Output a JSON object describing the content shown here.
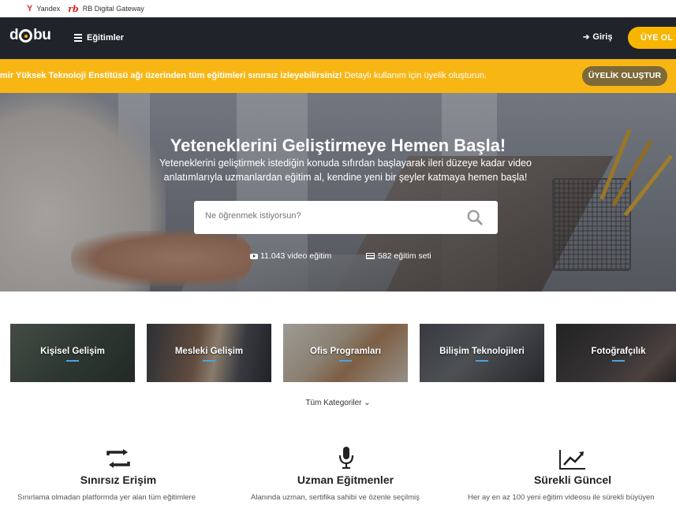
{
  "bookmarks": [
    {
      "icon": "Y",
      "label": "Yandex"
    },
    {
      "icon": "rb",
      "label": "RB Digital Gateway"
    }
  ],
  "navbar": {
    "logo": "dobu",
    "menu_label": "Eğitimler",
    "login_label": "Giriş",
    "join_label": "ÜYE OL"
  },
  "notice": {
    "bold_text": "mir Yüksek Teknoloji Enstitüsü ağı üzerinden tüm eğitimleri sınırsız izleyebilirsiniz!",
    "text": " Detaylı kullanım için üyelik oluşturun.",
    "button_label": "ÜYELİK OLUŞTUR"
  },
  "hero": {
    "title": "Yeteneklerini Geliştirmeye Hemen Başla!",
    "subtitle": "Yeteneklerini geliştirmek istediğin konuda sıfırdan başlayarak ileri düzeye kadar video anlatımlarıyla uzmanlardan eğitim al, kendine yeni bir şeyler katmaya hemen başla!",
    "search_placeholder": "Ne öğrenmek istiyorsun?",
    "video_count": "11.043 video eğitim",
    "set_count": "582 eğitim seti"
  },
  "categories": [
    {
      "label": "Kişisel Gelişim"
    },
    {
      "label": "Mesleki Gelişim"
    },
    {
      "label": "Ofis Programları"
    },
    {
      "label": "Bilişim Teknolojileri"
    },
    {
      "label": "Fotoğrafçılık"
    }
  ],
  "all_categories_label": "Tüm Kategoriler ⌄",
  "features": [
    {
      "icon": "repeat-icon",
      "title": "Sınırsız Erişim",
      "desc": "Sınırlama olmadan platformda yer alan tüm eğitimlere"
    },
    {
      "icon": "microphone-icon",
      "title": "Uzman Eğitmenler",
      "desc": "Alanında uzman, sertifika sahibi ve özenle seçilmiş"
    },
    {
      "icon": "trend-up-icon",
      "title": "Sürekli Güncel",
      "desc": "Her ay en az 100 yeni eğitim videosu ile sürekli büyüyen"
    }
  ],
  "colors": {
    "accent": "#f8b500",
    "navbar": "#20232a",
    "notice": "#f8b615",
    "category_underline": "#4aa3e6"
  }
}
